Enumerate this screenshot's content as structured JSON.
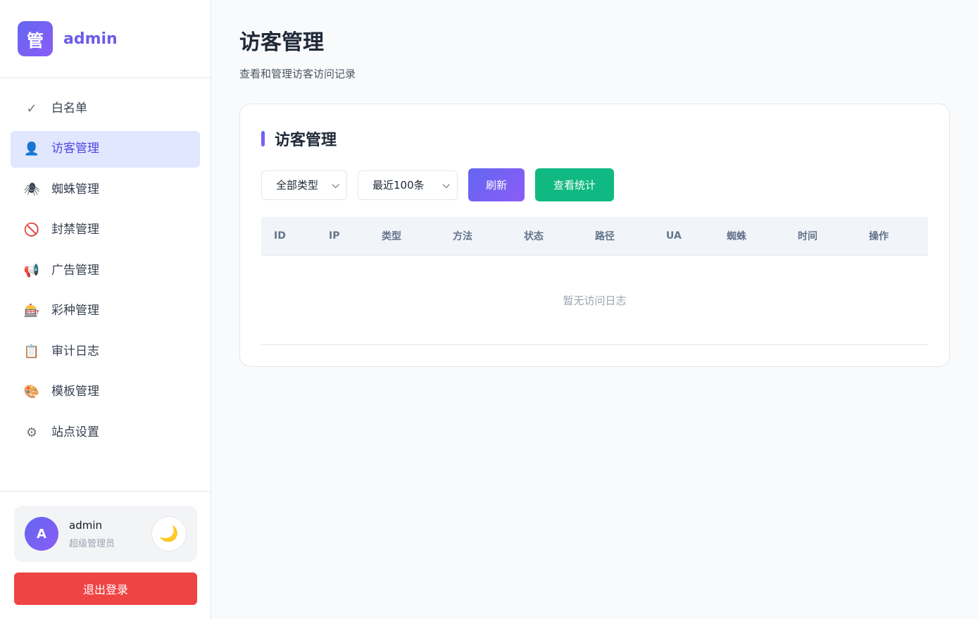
{
  "brand": {
    "logo_char": "管",
    "name": "admin"
  },
  "sidebar": {
    "items": [
      {
        "label": "白名单",
        "icon": "check-icon",
        "glyph": "✓",
        "active": false
      },
      {
        "label": "访客管理",
        "icon": "visitor-icon",
        "glyph": "👤",
        "active": true
      },
      {
        "label": "蜘蛛管理",
        "icon": "spider-icon",
        "glyph": "🕷",
        "active": false
      },
      {
        "label": "封禁管理",
        "icon": "ban-icon",
        "glyph": "🚫",
        "active": false
      },
      {
        "label": "广告管理",
        "icon": "megaphone-icon",
        "glyph": "📢",
        "active": false
      },
      {
        "label": "彩种管理",
        "icon": "slot-machine-icon",
        "glyph": "🎰",
        "active": false
      },
      {
        "label": "审计日志",
        "icon": "clipboard-icon",
        "glyph": "📋",
        "active": false
      },
      {
        "label": "模板管理",
        "icon": "palette-icon",
        "glyph": "🎨",
        "active": false
      },
      {
        "label": "站点设置",
        "icon": "gear-icon",
        "glyph": "⚙",
        "active": false
      }
    ]
  },
  "user": {
    "avatar": "A",
    "name": "admin",
    "role": "超级管理员",
    "theme_glyph": "🌙"
  },
  "logout_label": "退出登录",
  "header": {
    "title": "访客管理",
    "subtitle": "查看和管理访客访问记录"
  },
  "card": {
    "title": "访客管理",
    "filters": {
      "type_value": "全部类型",
      "limit_value": "最近100条"
    },
    "refresh_label": "刷新",
    "stats_label": "查看统计",
    "columns": [
      "ID",
      "IP",
      "类型",
      "方法",
      "状态",
      "路径",
      "UA",
      "蜘蛛",
      "时间",
      "操作"
    ],
    "empty_text": "暂无访问日志"
  },
  "colors": {
    "accent": "#6366f1",
    "danger": "#ef4444",
    "success": "#10b981"
  }
}
